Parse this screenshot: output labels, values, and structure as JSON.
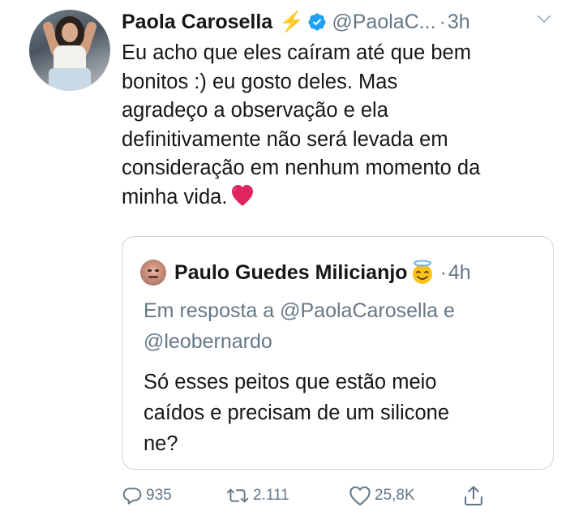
{
  "tweet": {
    "author_name": "Paola Carosella",
    "author_emoji": "⚡",
    "handle": "@PaolaC...",
    "separator": "·",
    "time": "3h",
    "body": "Eu acho que eles caíram até que bem\nbonitos :) eu gosto deles.  Mas\nagradeço a observação e ela\ndefinitivamente não será levada em\nconsideração em nenhum momento da\nminha vida.",
    "body_emoji": "heart-emoji",
    "verified_icon": "verified-badge-icon",
    "menu_icon": "chevron-down-icon"
  },
  "quoted": {
    "author_name": "Paulo Guedes Milicianjo",
    "author_emoji": "smiling-face-with-halo-emoji",
    "separator": "·",
    "time": "4h",
    "reply_context": "Em resposta a @PaolaCarosella e\n@leobernardo",
    "body": "Só esses peitos que estão meio\ncaídos e precisam de um silicone\nne?"
  },
  "actions": {
    "reply_count": "935",
    "retweet_count": "2.111",
    "like_count": "25,8K",
    "reply_icon": "reply-icon",
    "retweet_icon": "retweet-icon",
    "like_icon": "heart-icon",
    "share_icon": "share-icon"
  },
  "colors": {
    "text": "#14171a",
    "secondary": "#657786",
    "verified_blue": "#1da1f2",
    "border": "#ccd6dd",
    "bolt": "#f2b61b",
    "heart_red": "#e0245e"
  }
}
